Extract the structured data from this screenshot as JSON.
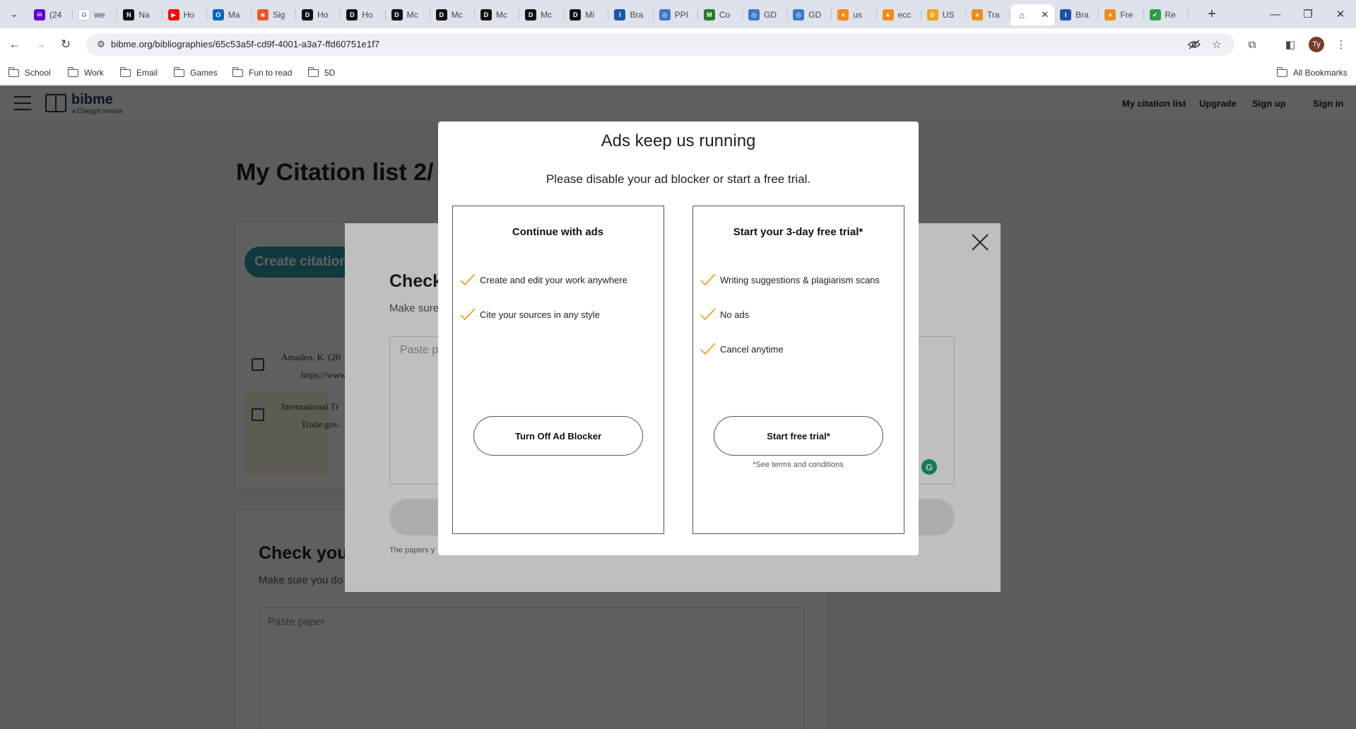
{
  "browser": {
    "tabs": [
      {
        "label": "(24",
        "icon": "mail-icon",
        "color": "#6001d2",
        "glyph": "✉"
      },
      {
        "label": "we",
        "icon": "google-icon",
        "color": "#ffffff",
        "glyph": "G"
      },
      {
        "label": "Na",
        "icon": "news-icon",
        "color": "#111111",
        "glyph": "N"
      },
      {
        "label": "Ho",
        "icon": "youtube-icon",
        "color": "#ff0000",
        "glyph": "▶"
      },
      {
        "label": "Ma",
        "icon": "outlook-icon",
        "color": "#0a64c8",
        "glyph": "O"
      },
      {
        "label": "Sig",
        "icon": "microsoft-icon",
        "color": "#f35325",
        "glyph": "■"
      },
      {
        "label": "Ho",
        "icon": "d2l-icon",
        "color": "#111111",
        "glyph": "D"
      },
      {
        "label": "Ho",
        "icon": "d2l-icon",
        "color": "#111111",
        "glyph": "D"
      },
      {
        "label": "Mc",
        "icon": "d2l-icon",
        "color": "#111111",
        "glyph": "D"
      },
      {
        "label": "Mc",
        "icon": "d2l-icon",
        "color": "#111111",
        "glyph": "D"
      },
      {
        "label": "Mc",
        "icon": "d2l-icon",
        "color": "#111111",
        "glyph": "D"
      },
      {
        "label": "Mc",
        "icon": "d2l-icon",
        "color": "#111111",
        "glyph": "D"
      },
      {
        "label": "Mi",
        "icon": "d2l-icon",
        "color": "#111111",
        "glyph": "D"
      },
      {
        "label": "Bra",
        "icon": "ita-icon",
        "color": "#1a56a7",
        "glyph": "I"
      },
      {
        "label": "PPI",
        "icon": "globe-icon",
        "color": "#3a77c8",
        "glyph": "◎"
      },
      {
        "label": "Co",
        "icon": "macrotrends-icon",
        "color": "#2a7a2a",
        "glyph": "M"
      },
      {
        "label": "GD",
        "icon": "globe-icon",
        "color": "#3a77c8",
        "glyph": "◎"
      },
      {
        "label": "GD",
        "icon": "globe-icon",
        "color": "#3a77c8",
        "glyph": "◎"
      },
      {
        "label": "us",
        "icon": "flame-icon",
        "color": "#f28c1a",
        "glyph": "♦"
      },
      {
        "label": "ecc",
        "icon": "flame-icon",
        "color": "#f28c1a",
        "glyph": "♦"
      },
      {
        "label": "US",
        "icon": "bing-icon",
        "color": "#f2a51a",
        "glyph": "b"
      },
      {
        "label": "Tra",
        "icon": "flame-icon",
        "color": "#f28c1a",
        "glyph": "♦"
      },
      {
        "label": "",
        "icon": "bibme-icon",
        "color": "#1e3a5f",
        "glyph": "⌂",
        "active": true
      },
      {
        "label": "Bra",
        "icon": "ita-icon",
        "color": "#1a56a7",
        "glyph": "I"
      },
      {
        "label": "Fre",
        "icon": "flame-icon",
        "color": "#f28c1a",
        "glyph": "♦"
      },
      {
        "label": "Re",
        "icon": "shield-icon",
        "color": "#2e9d4a",
        "glyph": "✔"
      }
    ],
    "url": "bibme.org/bibliographies/65c53a5f-cd9f-4001-a3a7-ffd60751e1f7",
    "profile_initials": "Ty",
    "bookmarks": [
      "School",
      "Work",
      "Email",
      "Games",
      "Fun to read",
      "5D"
    ],
    "all_bookmarks": "All Bookmarks"
  },
  "site": {
    "logo_text": "bibme",
    "logo_sub": "a Chegg® service",
    "nav": [
      "My citation list",
      "Upgrade",
      "Sign up",
      "Sign in"
    ],
    "page_title": "My Citation list 2/",
    "create_button": "Create citation",
    "citations": [
      {
        "line1": "Amadeo, K. (20",
        "line2": "https://www"
      },
      {
        "line1": "International Tr",
        "line2": "Trade.gov."
      }
    ],
    "check_title": "Check you",
    "check_sub": "Make sure you do",
    "paste_placeholder": "Paste paper"
  },
  "paper_modal": {
    "title": "Check",
    "sub": "Make sure",
    "placeholder": "Paste p",
    "footnote": "The papers y"
  },
  "ad_modal": {
    "title": "Ads keep us running",
    "subtitle": "Please disable your ad blocker or start a free trial.",
    "left": {
      "title": "Continue with ads",
      "features": [
        "Create and edit your work anywhere",
        "Cite your sources in any style"
      ],
      "button": "Turn Off Ad Blocker"
    },
    "right": {
      "title": "Start your 3-day free trial*",
      "features": [
        "Writing suggestions & plagiarism scans",
        "No ads",
        "Cancel anytime"
      ],
      "button": "Start free trial*",
      "terms": "*See terms and conditions"
    },
    "check_color": "#f0a020"
  }
}
